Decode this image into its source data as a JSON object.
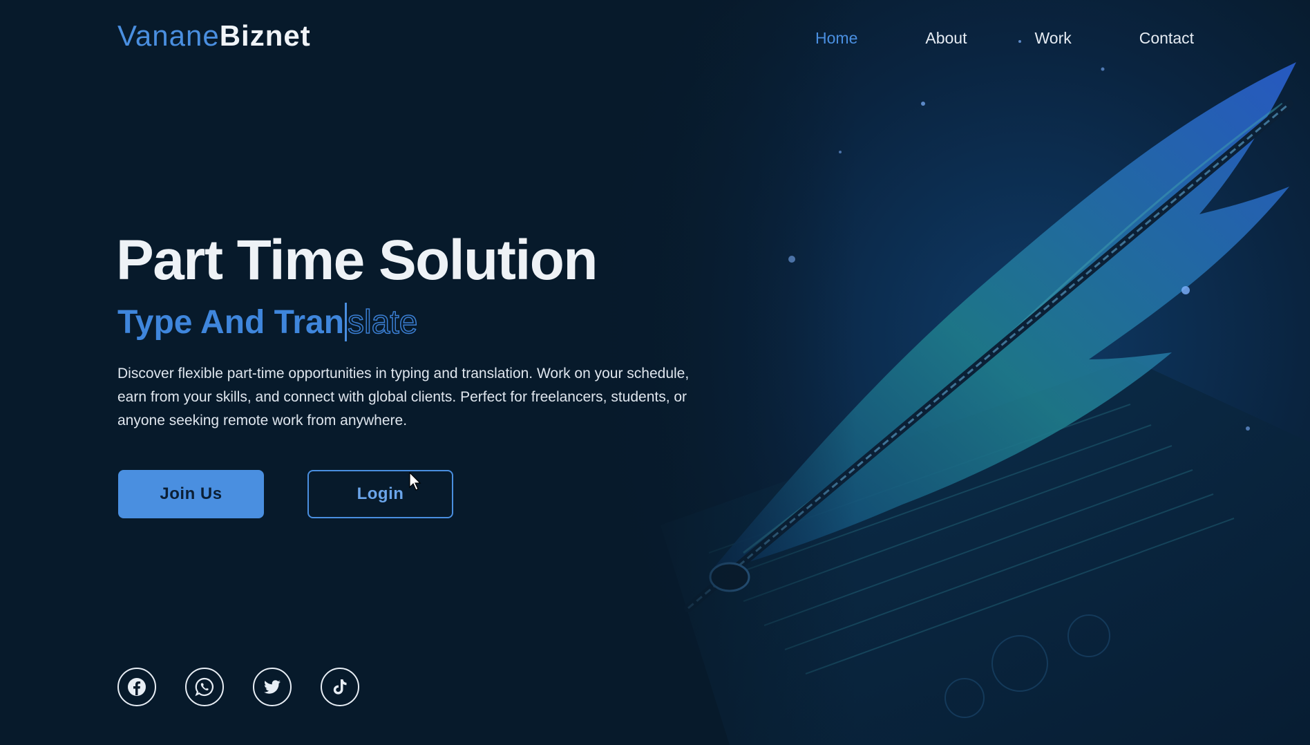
{
  "brand": {
    "part1": "Vanane",
    "part2": "Biznet"
  },
  "nav": {
    "items": [
      {
        "label": "Home",
        "active": true
      },
      {
        "label": "About",
        "active": false
      },
      {
        "label": "Work",
        "active": false
      },
      {
        "label": "Contact",
        "active": false
      }
    ]
  },
  "hero": {
    "headline": "Part Time Solution",
    "subhead_typed": "Type And Tran",
    "subhead_ghost": "slate",
    "description": "Discover flexible part-time opportunities in typing and translation. Work on your schedule, earn from your skills, and connect with global clients. Perfect for freelancers, students, or anyone seeking remote work from anywhere.",
    "join_label": "Join Us",
    "login_label": "Login"
  },
  "social": [
    "facebook-icon",
    "whatsapp-icon",
    "twitter-icon",
    "tiktok-icon"
  ],
  "colors": {
    "background": "#071a2b",
    "accent": "#4a8fe0",
    "text": "#e8eef5"
  }
}
